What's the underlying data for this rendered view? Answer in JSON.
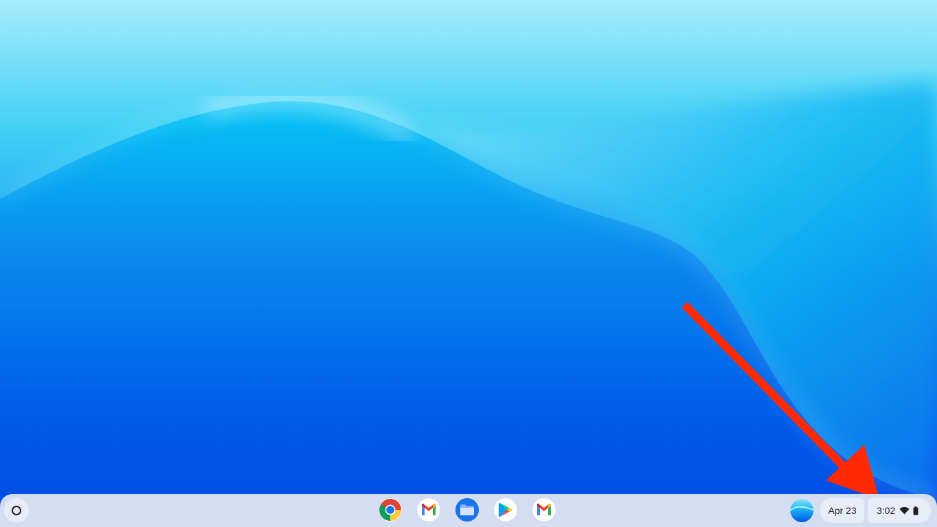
{
  "colors": {
    "shelf_background": "#d4ddf1",
    "pill_background": "#e7ecf7",
    "annotation_arrow": "#ff2a00",
    "wallpaper_top": "#a7ecfb",
    "wallpaper_bottom": "#0046e6"
  },
  "desktop": {
    "wallpaper": "blue-wave-wallpaper",
    "annotation": "red-arrow-pointing-to-clock"
  },
  "shelf": {
    "launcher_icon": "launcher-circle-icon",
    "pinned_apps": [
      {
        "name": "chrome",
        "icon": "chrome-icon"
      },
      {
        "name": "gmail",
        "icon": "gmail-icon"
      },
      {
        "name": "files",
        "icon": "files-icon"
      },
      {
        "name": "play-store",
        "icon": "play-store-icon"
      },
      {
        "name": "gmail",
        "icon": "gmail-icon"
      }
    ],
    "tray": {
      "avatar_icon": "account-avatar-icon",
      "date": "Apr 23",
      "time": "3:02",
      "wifi_icon": "wifi-icon",
      "battery_icon": "battery-icon"
    }
  }
}
